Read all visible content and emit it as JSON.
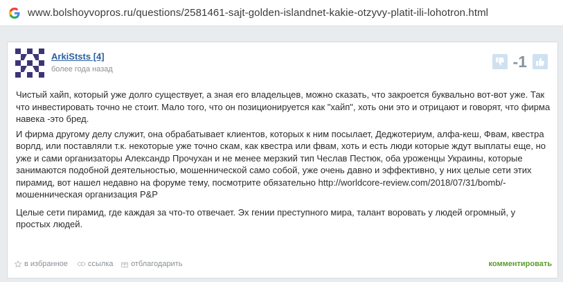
{
  "browser": {
    "url": "www.bolshoyvopros.ru/questions/2581461-sajt-golden-islandnet-kakie-otzyvy-platit-ili-lohotron.html"
  },
  "answer": {
    "author": "ArkiStsts [4]",
    "posted": "более года назад",
    "score": "-1",
    "paragraphs": [
      "Чистый хайп, который уже долго существует, а зная его владельцев, можно сказать, что закроется буквально вот-вот уже. Так что инвестировать точно не стоит. Мало того, что он позиционируется как \"хайп\", хоть они это и отрицают и говорят, что фирма навека -это бред.",
      "И фирма другому делу служит, она обрабатывает клиентов, которых к ним посылает, Деджотериум, алфа-кеш, Фвам, квестра ворлд, или поставляли т.к. некоторые уже точно скам, как квестра или фвам, хоть и есть люди которые ждут выплаты еще, но уже и сами организаторы Александр Прочухан и не менее мерзкий тип Чеслав Пестюк, оба уроженцы Украины, которые занимаются подобной деятельностью, мошеннической само собой, уже очень давно и эффективно, у них целые сети этих пирамид, вот нашел недавно на форуме тему, посмотрите обязательно http://worldcore-review.com/2018/07/31/bomb/-мошенническая организация P&P",
      "Целые сети пирамид, где каждая за что-то отвечает. Эх гении преступного мира, талант воровать у людей огромный, у простых людей."
    ],
    "actions": {
      "favorite": "в избранное",
      "link": "ссылка",
      "thank": "отблагодарить",
      "comment": "комментировать"
    }
  },
  "colors": {
    "link": "#2a5fa0",
    "comment": "#5a9c2e",
    "score": "#8693a1",
    "thumb_bg": "#cfe1f1"
  },
  "icons": [
    "google-icon",
    "avatar-pattern",
    "thumbs-down-icon",
    "thumbs-up-icon",
    "star-icon",
    "link-icon",
    "gift-icon"
  ]
}
